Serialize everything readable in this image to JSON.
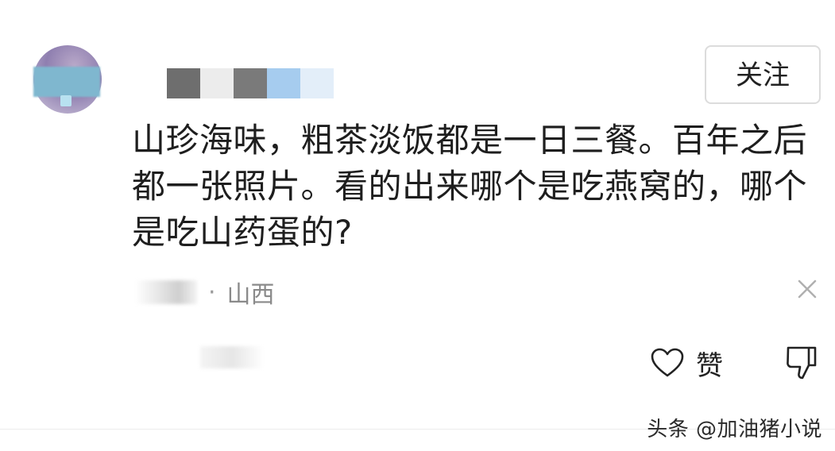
{
  "comment": {
    "follow_label": "关注",
    "text": "山珍海味，粗茶淡饭都是一日三餐。百年之后都一张照片。看的出来哪个是吃燕窝的，哪个是吃山药蛋的?",
    "meta_separator": "·",
    "location": "山西",
    "icons": {
      "close": "close-icon",
      "like": "heart-icon",
      "dislike": "thumbs-down-icon"
    },
    "like_label": "赞"
  },
  "watermark": "头条 @加油猪小说",
  "colors": {
    "text": "#1e1e1e",
    "meta": "#8a8a8a",
    "border": "#dcdcdc"
  }
}
